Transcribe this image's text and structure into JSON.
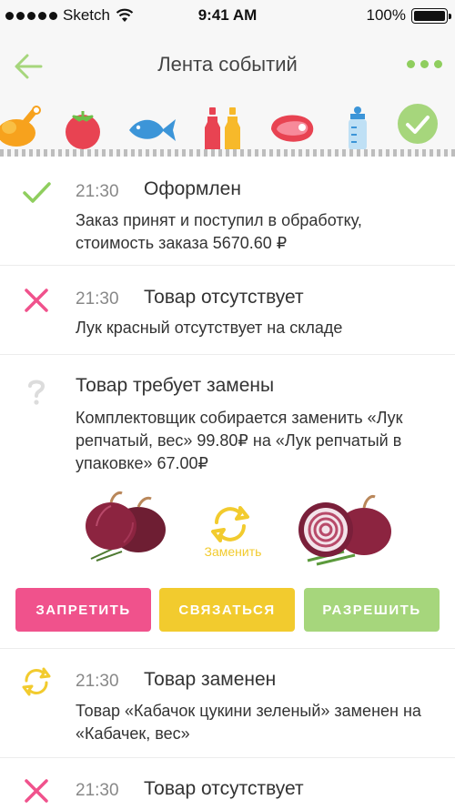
{
  "status_bar": {
    "carrier": "Sketch",
    "time": "9:41 AM",
    "battery": "100%"
  },
  "header": {
    "title": "Лента событий"
  },
  "categories": [
    "chicken-icon",
    "tomato-icon",
    "fish-icon",
    "bottles-icon",
    "meat-icon",
    "baby-bottle-icon",
    "checkmark-icon"
  ],
  "events": [
    {
      "status": "check",
      "time": "21:30",
      "title": "Оформлен",
      "text": "Заказ принят и поступил в обработку, стоимость заказа 5670.60 ₽"
    },
    {
      "status": "cross",
      "time": "21:30",
      "title": "Товар отсутствует",
      "text": "Лук красный отсутствует на складе"
    },
    {
      "status": "question",
      "title": "Товар требует замены",
      "text": "Комплектовщик собирается заменить «Лук репчатый, вес» 99.80₽ на «Лук репчатый в упаковке» 67.00₽",
      "swap_label": "Заменить",
      "actions": {
        "forbid": "ЗАПРЕТИТЬ",
        "contact": "СВЯЗАТЬСЯ",
        "allow": "РАЗРЕШИТЬ"
      }
    },
    {
      "status": "replaced",
      "time": "21:30",
      "title": "Товар заменен",
      "text": "Товар «Кабачок цукини зеленый» заменен на «Кабачек, вес»"
    },
    {
      "status": "cross",
      "time": "21:30",
      "title": "Товар отсутствует"
    }
  ],
  "colors": {
    "green": "#8fce5e",
    "pink": "#f0528c",
    "yellow": "#f2cb2e",
    "gray_icon": "#dcdcdc"
  }
}
